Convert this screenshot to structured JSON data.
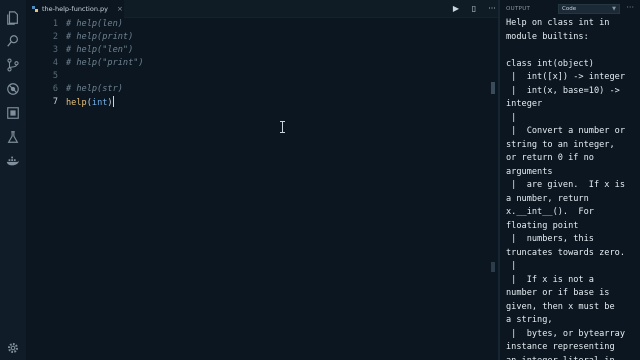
{
  "tab": {
    "label": "the-help-function.py",
    "close": "×"
  },
  "editor_actions": {
    "run": "▶",
    "split": "▯",
    "more": "···"
  },
  "gutter": [
    "1",
    "2",
    "3",
    "4",
    "5",
    "6",
    "7"
  ],
  "code": {
    "l1": "# help(len)",
    "l2": "# help(print)",
    "l3": "# help(\"len\")",
    "l4": "# help(\"print\")",
    "l6": "# help(str)",
    "l7_fn": "help",
    "l7_open": "(",
    "l7_arg": "int",
    "l7_close": ")"
  },
  "output": {
    "title": "OUTPUT",
    "select": "Code",
    "more": "···",
    "lines": [
      "Help on class int in",
      "module builtins:",
      "",
      "class int(object)",
      " |  int([x]) -> integer",
      " |  int(x, base=10) ->",
      "integer",
      " |",
      " |  Convert a number or",
      "string to an integer,",
      "or return 0 if no",
      "arguments",
      " |  are given.  If x is",
      "a number, return",
      "x.__int__().  For",
      "floating point",
      " |  numbers, this",
      "truncates towards zero.",
      " |",
      " |  If x is not a",
      "number or if base is",
      "given, then x must be",
      "a string,",
      " |  bytes, or bytearray",
      "instance representing",
      "an integer literal in"
    ]
  },
  "colors": {
    "background": "#0b1620",
    "comment": "#6f8290",
    "function": "#e6c07b",
    "argument": "#72aee6"
  }
}
